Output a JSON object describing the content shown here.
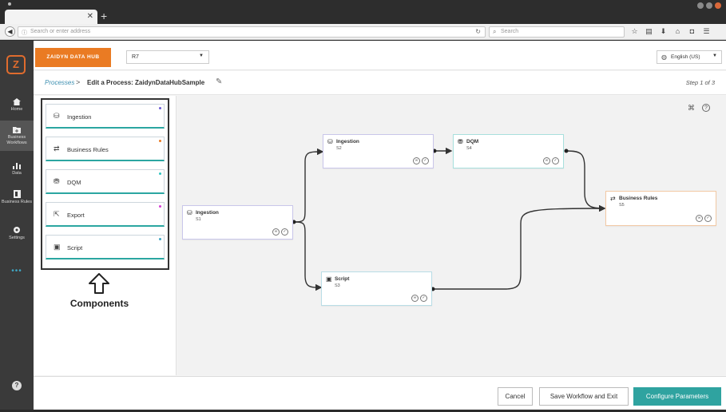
{
  "browser": {
    "url_placeholder": "Search or enter address",
    "search_placeholder": "Search"
  },
  "topbar": {
    "brand": "ZAIDYN DATA HUB",
    "selector_value": "R7",
    "language": "English (US)"
  },
  "sidebar": {
    "items": [
      {
        "label": "Home"
      },
      {
        "label": "Business Workflows"
      },
      {
        "label": "Data"
      },
      {
        "label": "Business Rules"
      },
      {
        "label": "Settings"
      }
    ],
    "more": "•••",
    "help": "?"
  },
  "breadcrumb": {
    "link": "Processes",
    "separator": ">",
    "title": "Edit a Process: ZaidynDataHubSample",
    "step": "Step 1 of 3"
  },
  "components": {
    "items": [
      {
        "label": "Ingestion",
        "icon": "database-icon",
        "dot_color": "#6b5bd6"
      },
      {
        "label": "Business Rules",
        "icon": "rules-icon",
        "dot_color": "#ea7b23"
      },
      {
        "label": "DQM",
        "icon": "dqm-icon",
        "dot_color": "#2fc4c0"
      },
      {
        "label": "Export",
        "icon": "export-icon",
        "dot_color": "#d63bd6"
      },
      {
        "label": "Script",
        "icon": "script-icon",
        "dot_color": "#3fa7c4"
      }
    ],
    "caption": "Components"
  },
  "workflow": {
    "nodes": [
      {
        "title": "Ingestion",
        "sub": "S1",
        "border": "#c9c6ea"
      },
      {
        "title": "Ingestion",
        "sub": "S2",
        "border": "#c9c6ea"
      },
      {
        "title": "DQM",
        "sub": "S4",
        "border": "#a8e0dd"
      },
      {
        "title": "Business Rules",
        "sub": "S5",
        "border": "#f2c9a4"
      },
      {
        "title": "Script",
        "sub": "S3",
        "border": "#b9dde6"
      }
    ]
  },
  "zoom": {
    "in": "+",
    "out": "−"
  },
  "footer": {
    "cancel": "Cancel",
    "save_exit": "Save Workflow and Exit",
    "configure": "Configure Parameters"
  }
}
